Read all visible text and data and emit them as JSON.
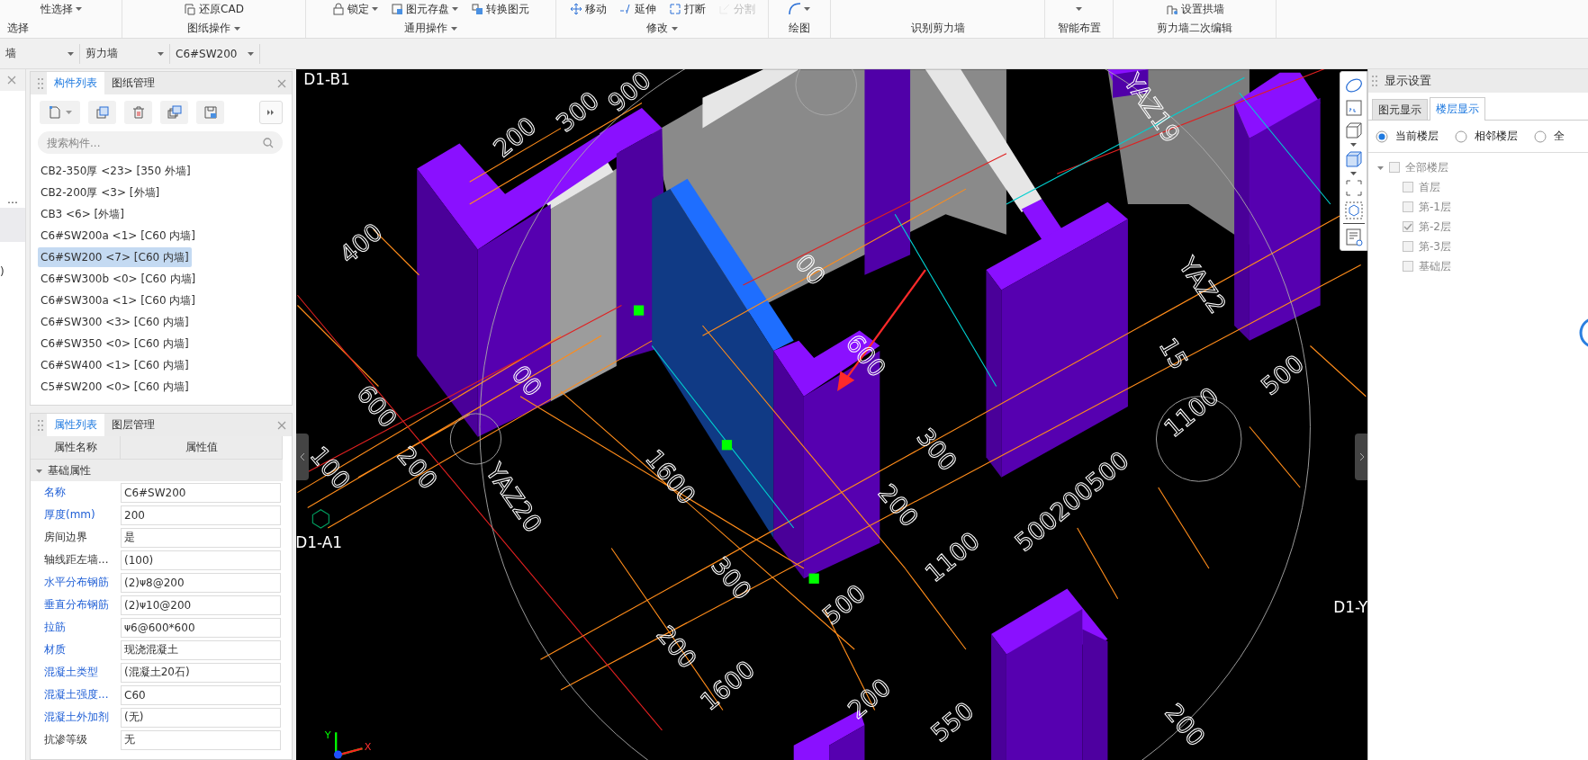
{
  "ribbon": {
    "groups": [
      {
        "label": "选择",
        "caret": false,
        "buttons": [
          {
            "text": "性选择",
            "caret": true,
            "disabled": false
          }
        ]
      },
      {
        "label": "图纸操作",
        "caret": true,
        "buttons": [
          {
            "text": "还原CAD",
            "caret": false,
            "disabled": false
          }
        ]
      },
      {
        "label": "通用操作",
        "caret": true,
        "buttons": [
          {
            "text": "锁定",
            "caret": true,
            "disabled": false
          },
          {
            "text": "图元存盘",
            "caret": true,
            "disabled": false
          },
          {
            "text": "转换图元",
            "caret": false,
            "disabled": false
          }
        ]
      },
      {
        "label": "修改",
        "caret": true,
        "buttons": [
          {
            "text": "移动",
            "caret": false,
            "disabled": false
          },
          {
            "text": "延伸",
            "caret": false,
            "disabled": false
          },
          {
            "text": "打断",
            "caret": false,
            "disabled": false
          },
          {
            "text": "分割",
            "caret": false,
            "disabled": true
          }
        ]
      },
      {
        "label": "绘图",
        "caret": false,
        "buttons": [
          {
            "caret": true,
            "disabled": false
          }
        ]
      },
      {
        "label": "识别剪力墙",
        "caret": false
      },
      {
        "label": "智能布置",
        "caret": false,
        "buttons": [
          {
            "caret": true,
            "disabled": false
          }
        ]
      },
      {
        "label": "剪力墙二次编辑",
        "caret": false,
        "buttons": [
          {
            "text": "设置拱墙",
            "caret": false,
            "disabled": false
          }
        ]
      }
    ]
  },
  "selectors": [
    {
      "value": "墙"
    },
    {
      "value": "剪力墙"
    },
    {
      "value": "C6#SW200"
    }
  ],
  "left_stub": {
    "texts": [
      "…",
      ")"
    ]
  },
  "component_panel": {
    "tabs": [
      {
        "label": "构件列表",
        "selected": true
      },
      {
        "label": "图纸管理",
        "selected": false
      }
    ],
    "search": {
      "placeholder": "搜索构件..."
    },
    "items": [
      {
        "text": "CB2-350厚 <23> [350 外墙]",
        "selected": false
      },
      {
        "text": "CB2-200厚 <3> [外墙]",
        "selected": false
      },
      {
        "text": "CB3 <6> [外墙]",
        "selected": false
      },
      {
        "text": "C6#SW200a <1> [C60 内墙]",
        "selected": false
      },
      {
        "text": "C6#SW200 <7> [C60 内墙]",
        "selected": true
      },
      {
        "text": "C6#SW300b <0> [C60 内墙]",
        "selected": false
      },
      {
        "text": "C6#SW300a <1> [C60 内墙]",
        "selected": false
      },
      {
        "text": "C6#SW300 <3> [C60 内墙]",
        "selected": false
      },
      {
        "text": "C6#SW350 <0> [C60 内墙]",
        "selected": false
      },
      {
        "text": "C6#SW400 <1> [C60 内墙]",
        "selected": false
      },
      {
        "text": "C5#SW200 <0> [C60 内墙]",
        "selected": false
      }
    ]
  },
  "property_panel": {
    "tabs": [
      {
        "label": "属性列表",
        "selected": true
      },
      {
        "label": "图层管理",
        "selected": false
      }
    ],
    "columns": [
      "属性名称",
      "属性值"
    ],
    "group": {
      "label": "基础属性",
      "expanded": true
    },
    "rows": [
      {
        "name": "名称",
        "value": "C6#SW200",
        "kind": "public"
      },
      {
        "name": "厚度(mm)",
        "value": "200",
        "kind": "public"
      },
      {
        "name": "房间边界",
        "value": "是",
        "kind": "private"
      },
      {
        "name": "轴线距左墙...",
        "value": "(100)",
        "kind": "private"
      },
      {
        "name": "水平分布钢筋",
        "value": "(2)ᴪ8@200",
        "kind": "public"
      },
      {
        "name": "垂直分布钢筋",
        "value": "(2)ᴪ10@200",
        "kind": "public"
      },
      {
        "name": "拉筋",
        "value": "ᴪ6@600*600",
        "kind": "public"
      },
      {
        "name": "材质",
        "value": "现浇混凝土",
        "kind": "public"
      },
      {
        "name": "混凝土类型",
        "value": "(混凝土20石)",
        "kind": "public"
      },
      {
        "name": "混凝土强度...",
        "value": "C60",
        "kind": "public"
      },
      {
        "name": "混凝土外加剂",
        "value": "(无)",
        "kind": "public"
      },
      {
        "name": "抗渗等级",
        "value": "无",
        "kind": "private"
      }
    ]
  },
  "viewport": {
    "axis_labels": [
      "D1-B1",
      "D1-A1",
      "D1-Y"
    ],
    "dimension_labels": [
      "200",
      "300",
      "900",
      "400",
      "600",
      "00",
      "100",
      "200",
      "YAZ20",
      "1600",
      "00",
      "600",
      "300",
      "200",
      "15",
      "YAZ19",
      "YAZ2",
      "500",
      "1100",
      "500200500",
      "1100",
      "300",
      "500",
      "200",
      "1600",
      "200",
      "550",
      "200"
    ],
    "axis_gizmo": {
      "y_label": "Y",
      "x_label": "X"
    }
  },
  "display_settings": {
    "title": "显示设置",
    "tabs": [
      {
        "label": "图元显示",
        "selected": false
      },
      {
        "label": "楼层显示",
        "selected": true
      }
    ],
    "scope": [
      {
        "label": "当前楼层",
        "selected": true
      },
      {
        "label": "相邻楼层",
        "selected": false
      },
      {
        "label": "全",
        "selected": false
      }
    ],
    "tree": {
      "label": "全部楼层",
      "checked": false,
      "expanded": true,
      "children": [
        {
          "label": "首层",
          "checked": false
        },
        {
          "label": "第-1层",
          "checked": false
        },
        {
          "label": "第-2层",
          "checked": true
        },
        {
          "label": "第-3层",
          "checked": false
        },
        {
          "label": "基础层",
          "checked": false
        }
      ]
    }
  }
}
